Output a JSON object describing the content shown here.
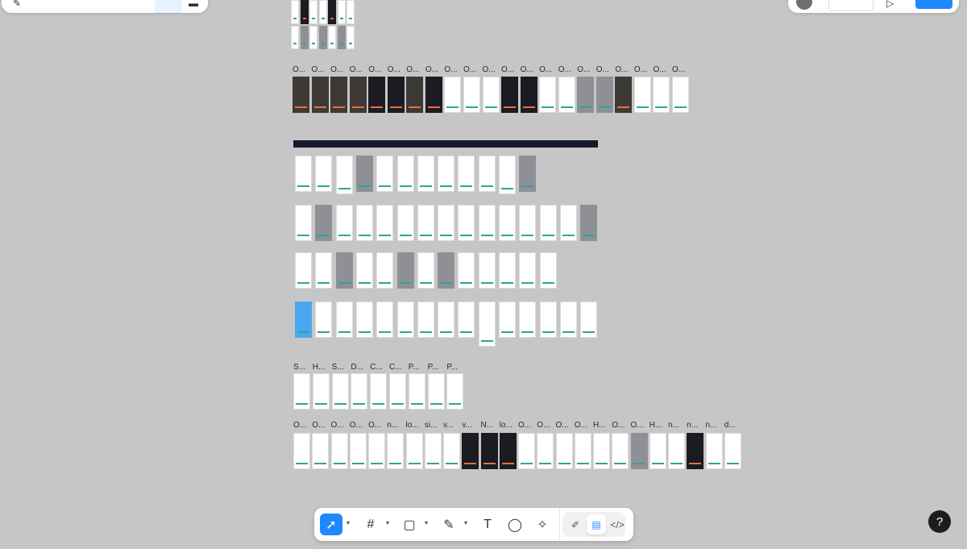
{
  "top_left_panel": {
    "icons": [
      "pen-icon",
      "frame-icon"
    ]
  },
  "top_right_panel": {
    "icons": [
      "avatar",
      "play-icon"
    ]
  },
  "section_labels": {
    "row1": [
      "O...",
      "O...",
      "O...",
      "O...",
      "O...",
      "O...",
      "O...",
      "O...",
      "O...",
      "O...",
      "O...",
      "O...",
      "O...",
      "O...",
      "O...",
      "O...",
      "O...",
      "O...",
      "O...",
      "O...",
      "O..."
    ],
    "row_shop": [
      "S...",
      "H...",
      "S...",
      "D...",
      "C...",
      "C...",
      "P...",
      "P...",
      "P..."
    ],
    "row_last": [
      "O...",
      "O...",
      "O...",
      "O...",
      "O...",
      "n...",
      "lo...",
      "si...",
      "v...",
      "v...",
      "N...",
      "lo...",
      "O...",
      "O...",
      "O...",
      "O...",
      "H...",
      "O...",
      "O...",
      "H...",
      "n...",
      "n...",
      "n...",
      "d..."
    ]
  },
  "toolbar": {
    "tools": [
      {
        "name": "move-tool",
        "icon": "cursor-icon",
        "glyph": "➚",
        "active": true
      },
      {
        "name": "frame-tool",
        "icon": "hash-frame-icon",
        "glyph": "#",
        "active": false
      },
      {
        "name": "rectangle-tool",
        "icon": "square-icon",
        "glyph": "▢",
        "active": false
      },
      {
        "name": "pen-tool",
        "icon": "pen-nib-icon",
        "glyph": "✎",
        "active": false
      },
      {
        "name": "text-tool",
        "icon": "text-icon",
        "glyph": "T",
        "active": false
      },
      {
        "name": "comment-tool",
        "icon": "comment-icon",
        "glyph": "◯",
        "active": false
      },
      {
        "name": "ai-tool",
        "icon": "sparkle-icon",
        "glyph": "✧",
        "active": false
      }
    ],
    "modes": [
      {
        "name": "draw-mode",
        "icon": "pencil-mode-icon",
        "glyph": "✐",
        "active": false
      },
      {
        "name": "design-mode",
        "icon": "design-mode-icon",
        "glyph": "▤",
        "active": true
      },
      {
        "name": "dev-mode",
        "icon": "code-icon",
        "glyph": "</>",
        "active": false
      }
    ]
  },
  "help_button": {
    "label": "?"
  },
  "colors": {
    "canvas": "#c6c6c6",
    "accent": "#1e88ff",
    "banner": "#141a2e"
  }
}
